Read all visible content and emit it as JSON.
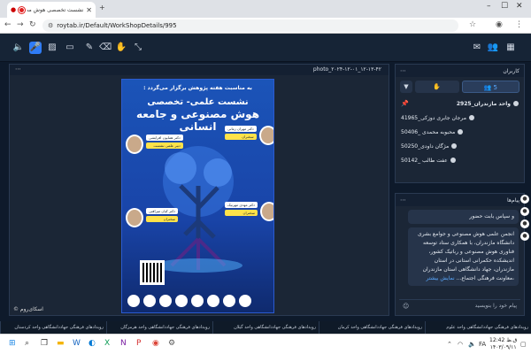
{
  "browser": {
    "tab_title": "نشست تخصصی هوش مصنوعی",
    "url": "roytab.ir/Default/WorkShopDetails/995"
  },
  "stage": {
    "title": "photo_۲۰۲۴-۱۲-۰۱_۱۲-۱۳-۴۲",
    "watermark": "اسکای‌روم ©"
  },
  "poster": {
    "intro": "به مناسبت هفته پژوهش برگزار می‌گردد :",
    "title_line1": "نشست علمی- تخصصی",
    "title_line2": "هوش مصنوعی و جامعه انسانی",
    "speakers": [
      {
        "name": "دکتر مهران زمانی",
        "role": "سخنران"
      },
      {
        "name": "دکتر همایون افرایشی",
        "role": "دبیر علمی نشست"
      },
      {
        "name": "دکتر مهدی مهرنیک",
        "role": "سخنران"
      },
      {
        "name": "دکتر کیان میرافتی",
        "role": "سخنران"
      }
    ]
  },
  "users_panel": {
    "title": "کاربران",
    "filter_all_count": "5",
    "users": [
      {
        "name": "واحد مازندران_2925"
      },
      {
        "name": "مرجان جابری دوزکی_41965"
      },
      {
        "name": "محبوبه محمدی _50406"
      },
      {
        "name": "مژگان داودی_50250"
      },
      {
        "name": "عفت طالب _50142"
      }
    ]
  },
  "chat_panel": {
    "title": "پیام‌ها",
    "msg1": "و سپاس بابت حضور",
    "msg2": "انجمن علمی هوش مصنوعی و جوامع بشری دانشگاه مازندران، با همکاری ستاد توسعه فناوری هوش مصنوعی و رباتیک کشور، اندیشکده حکمرانی استانی در استان مازندران، جهاد دانشگاهی استان مازندران ،معاونت فرهنگی اجتماع...",
    "msg2_link": "نمایش بیشتر",
    "input_placeholder": "پیام خود را بنویسید"
  },
  "bottom_tabs": [
    "رویدادهای فرهنگی جهاددانشگاهی واحد علوم",
    "رویدادهای فرهنگی جهاددانشگاهی واحد کرمان",
    "رویدادهای فرهنگی جهاددانشگاهی واحد گیلان",
    "رویدادهای فرهنگی جهاددانشگاهی واحد هرمزگان",
    "رویدادهای فرهنگی جهاددانشگاهی واحد کردستان"
  ],
  "taskbar": {
    "time": "12:42 ق.ظ",
    "date": "۱۴۰۳/۰۹/۱۱",
    "lang": "FA"
  }
}
